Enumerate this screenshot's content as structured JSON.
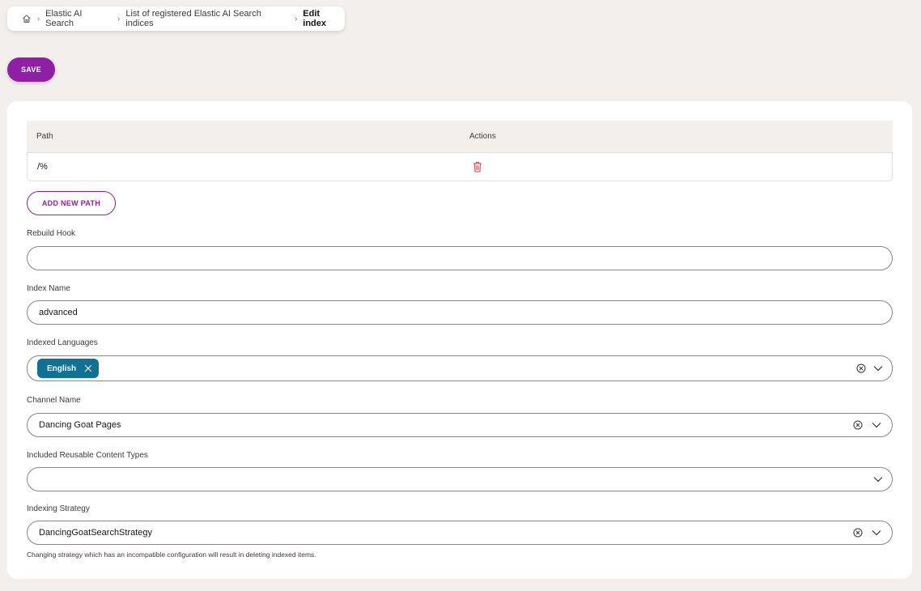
{
  "breadcrumb": {
    "home_icon": "home-icon",
    "items": [
      "Elastic AI Search",
      "List of registered Elastic AI Search indices"
    ],
    "current": "Edit index"
  },
  "toolbar": {
    "save_label": "SAVE"
  },
  "paths_table": {
    "headers": {
      "path": "Path",
      "actions": "Actions"
    },
    "rows": [
      {
        "path": "/%",
        "action_icon": "trash-icon"
      }
    ],
    "add_label": "ADD NEW PATH"
  },
  "form": {
    "rebuild_hook": {
      "label": "Rebuild Hook",
      "value": ""
    },
    "index_name": {
      "label": "Index Name",
      "value": "advanced"
    },
    "indexed_languages": {
      "label": "Indexed Languages",
      "chips": [
        "English"
      ]
    },
    "channel_name": {
      "label": "Channel Name",
      "value": "Dancing Goat Pages"
    },
    "reusable_types": {
      "label": "Included Reusable Content Types",
      "value": ""
    },
    "indexing_strategy": {
      "label": "Indexing Strategy",
      "value": "DancingGoatSearchStrategy",
      "hint": "Changing strategy which has an incompatible configuration will result in deleting indexed items."
    }
  },
  "colors": {
    "accent": "#8f1fa4",
    "chip": "#0f7196",
    "background": "#f3efec",
    "danger": "#e0414b"
  }
}
